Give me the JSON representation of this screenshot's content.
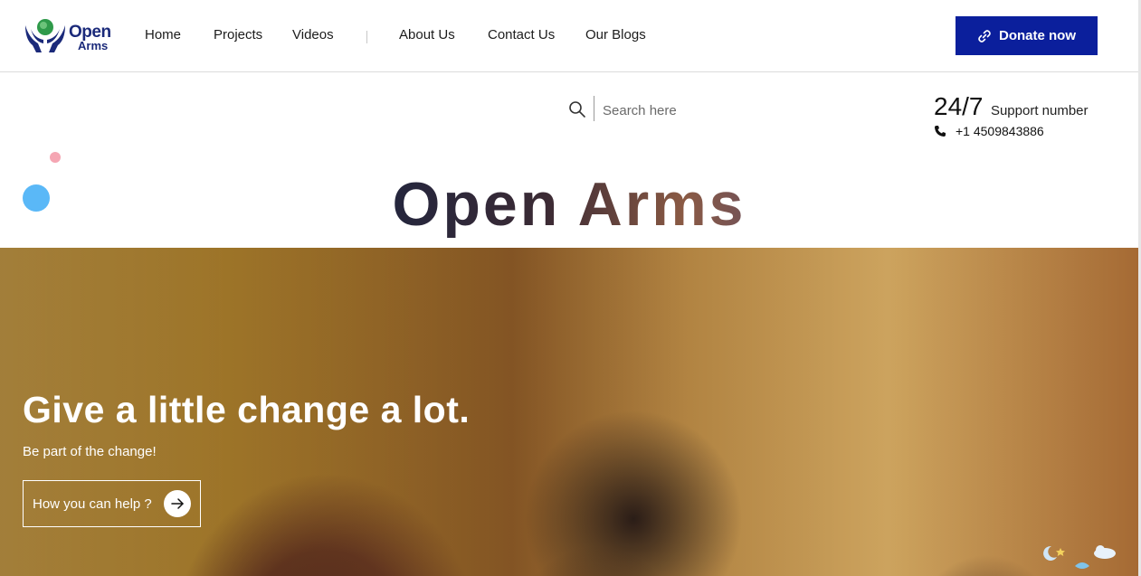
{
  "brand": {
    "logo_line1": "Open",
    "logo_line2": "Arms",
    "primary_color": "#0b1f9c",
    "logo_color": "#1b2a7a"
  },
  "nav": {
    "items": [
      {
        "label": "Home"
      },
      {
        "label": "Projects"
      },
      {
        "label": "Videos"
      },
      {
        "label": "About Us"
      },
      {
        "label": "Contact Us"
      },
      {
        "label": "Our Blogs"
      }
    ]
  },
  "donate": {
    "label": "Donate now",
    "icon": "link-icon"
  },
  "search": {
    "placeholder": "Search here",
    "value": "",
    "icon": "search-icon"
  },
  "support": {
    "hours": "24/7",
    "label": "Support number",
    "phone": "+1 4509843886",
    "icon": "phone-icon"
  },
  "headline": "Open Arms",
  "hero": {
    "title": "Give a little change a lot.",
    "subtitle": "Be part of the change!",
    "cta_label": "How you can help ?",
    "cta_icon": "arrow-right-icon"
  },
  "decor": {
    "dot_pink": "#f5a6b3",
    "dot_blue": "#5ab8f7"
  }
}
